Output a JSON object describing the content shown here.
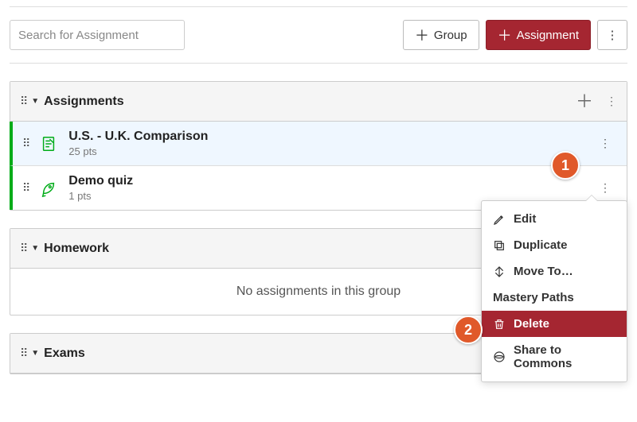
{
  "toolbar": {
    "search_placeholder": "Search for Assignment",
    "group_button": "Group",
    "assignment_button": "Assignment"
  },
  "groups": [
    {
      "title": "Assignments",
      "items": [
        {
          "title": "U.S. - U.K. Comparison",
          "points": "25 pts",
          "highlight": true,
          "type": "document"
        },
        {
          "title": "Demo quiz",
          "points": "1 pts",
          "highlight": false,
          "type": "quiz"
        }
      ]
    },
    {
      "title": "Homework",
      "empty_message": "No assignments in this group"
    },
    {
      "title": "Exams"
    }
  ],
  "menu": {
    "edit": "Edit",
    "duplicate": "Duplicate",
    "move_to": "Move To…",
    "mastery_paths": "Mastery Paths",
    "delete": "Delete",
    "share_commons": "Share to Commons"
  },
  "markers": {
    "one": "1",
    "two": "2"
  }
}
